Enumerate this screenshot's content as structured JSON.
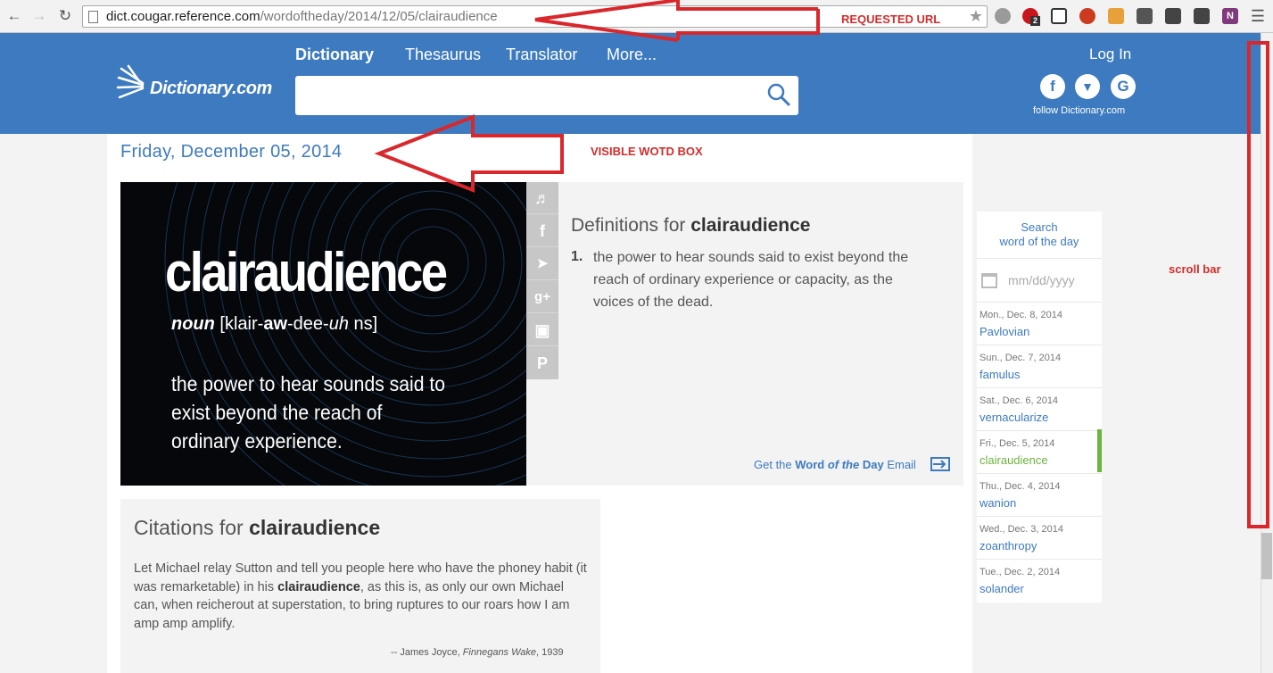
{
  "browser": {
    "url_host": "dict.cougar.reference.com",
    "url_path": "/wordoftheday/2014/12/05/clairaudience",
    "ext_badge": "2"
  },
  "header": {
    "logo": "Dictionary.com",
    "nav": [
      "Dictionary",
      "Thesaurus",
      "Translator",
      "More..."
    ],
    "login": "Log In",
    "follow": "follow Dictionary.com"
  },
  "wotd": {
    "date": "Friday, December 05, 2014",
    "word": "clairaudience",
    "pos": "noun",
    "pron_1": " [klair-",
    "pron_2": "aw",
    "pron_3": "-dee-",
    "pron_4": "uh",
    "pron_5": " ns]",
    "image_definition": "the power to hear sounds said to exist beyond the reach of ordinary experience.",
    "definitions_prefix": "Definitions for ",
    "definition_number": "1.",
    "definition": "the power to hear sounds said to exist beyond the reach of ordinary experience or capacity, as the voices of the dead.",
    "email_1": "Get the ",
    "email_2": "Word ",
    "email_3": "of the",
    "email_4": " Day",
    "email_5": " Email"
  },
  "citations": {
    "prefix": "Citations for ",
    "word": "clairaudience",
    "text_before": "Let Michael relay Sutton and tell you people here who have the phoney habit (it was remarketable) in his ",
    "text_bold": "clairaudience",
    "text_after": ", as this is, as only our own Michael can, when reicherout at superstation, to bring ruptures to our roars how I am amp amp amplify.",
    "source_prefix": "-- James Joyce, ",
    "source_title": "Finnegans Wake",
    "source_suffix": ", 1939"
  },
  "sidebar": {
    "title_1": "Search",
    "title_2": "word of the day",
    "date_placeholder": "mm/dd/yyyy",
    "items": [
      {
        "date": "Mon., Dec. 8, 2014",
        "word": "Pavlovian"
      },
      {
        "date": "Sun., Dec. 7, 2014",
        "word": "famulus"
      },
      {
        "date": "Sat., Dec. 6, 2014",
        "word": "vernacularize"
      },
      {
        "date": "Fri., Dec. 5, 2014",
        "word": "clairaudience"
      },
      {
        "date": "Thu., Dec. 4, 2014",
        "word": "wanion"
      },
      {
        "date": "Wed., Dec. 3, 2014",
        "word": "zoanthropy"
      },
      {
        "date": "Tue., Dec. 2, 2014",
        "word": "solander"
      }
    ],
    "selected_index": 3
  },
  "annotations": {
    "requested_url": "REQUESTED URL",
    "visible_wotd": "VISIBLE WOTD BOX",
    "scroll_bar": "scroll bar",
    "color": "#d9272c"
  },
  "colors": {
    "brand_blue": "#3d7ac0",
    "selected_green": "#6cb33f"
  }
}
